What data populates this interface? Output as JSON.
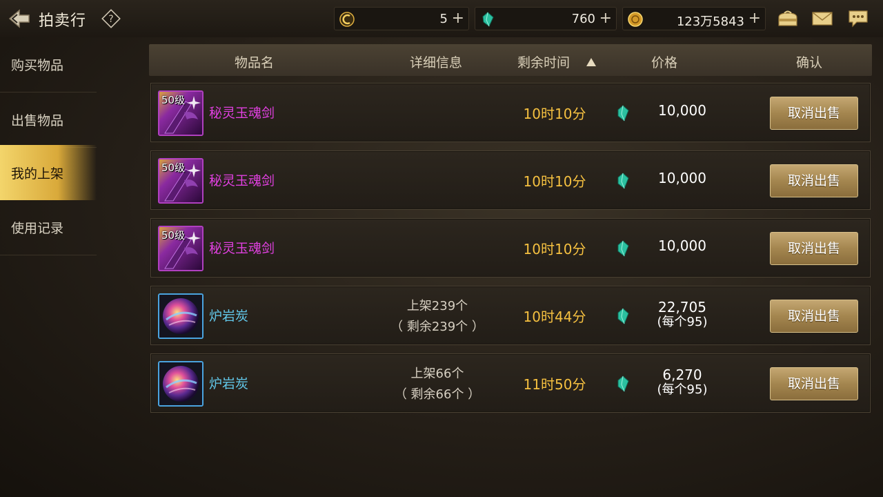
{
  "header": {
    "title": "拍卖行",
    "back_icon": "back-arrow-icon",
    "help_icon": "help-diamond-icon"
  },
  "currencies": [
    {
      "name": "c-coin",
      "icon": "crescent-coin-icon",
      "value": "5"
    },
    {
      "name": "gem",
      "icon": "green-gem-icon",
      "value": "760"
    },
    {
      "name": "gold",
      "icon": "gold-coin-icon",
      "value": "123万5843"
    }
  ],
  "top_icons": [
    "bag-icon",
    "mail-icon",
    "chat-icon"
  ],
  "sidebar": {
    "items": [
      {
        "label": "购买物品",
        "active": false
      },
      {
        "label": "出售物品",
        "active": false
      },
      {
        "label": "我的上架",
        "active": true
      },
      {
        "label": "使用记录",
        "active": false
      }
    ]
  },
  "table": {
    "headers": {
      "name": "物品名",
      "detail": "详细信息",
      "time": "剩余时间",
      "price": "价格",
      "confirm": "确认"
    },
    "rows": [
      {
        "level": "50级",
        "name": "秘灵玉魂剑",
        "rarity": "purple",
        "detail1": "",
        "detail2": "",
        "time": "10时10分",
        "price": "10,000",
        "per": "",
        "button": "取消出售"
      },
      {
        "level": "50级",
        "name": "秘灵玉魂剑",
        "rarity": "purple",
        "detail1": "",
        "detail2": "",
        "time": "10时10分",
        "price": "10,000",
        "per": "",
        "button": "取消出售"
      },
      {
        "level": "50级",
        "name": "秘灵玉魂剑",
        "rarity": "purple",
        "detail1": "",
        "detail2": "",
        "time": "10时10分",
        "price": "10,000",
        "per": "",
        "button": "取消出售"
      },
      {
        "level": "",
        "name": "炉岩炭",
        "rarity": "cyan",
        "detail1": "上架239个",
        "detail2": "（ 剩余239个 ）",
        "time": "10时44分",
        "price": "22,705",
        "per": "(每个95)",
        "button": "取消出售"
      },
      {
        "level": "",
        "name": "炉岩炭",
        "rarity": "cyan",
        "detail1": "上架66个",
        "detail2": "（ 剩余66个 ）",
        "time": "11时50分",
        "price": "6,270",
        "per": "(每个95)",
        "button": "取消出售"
      }
    ]
  },
  "colors": {
    "accent_gold": "#f3d56b",
    "time_text": "#f5c040",
    "rare_purple": "#e040e0",
    "rare_cyan": "#62c8ea",
    "button_gold": "#a4864f"
  }
}
